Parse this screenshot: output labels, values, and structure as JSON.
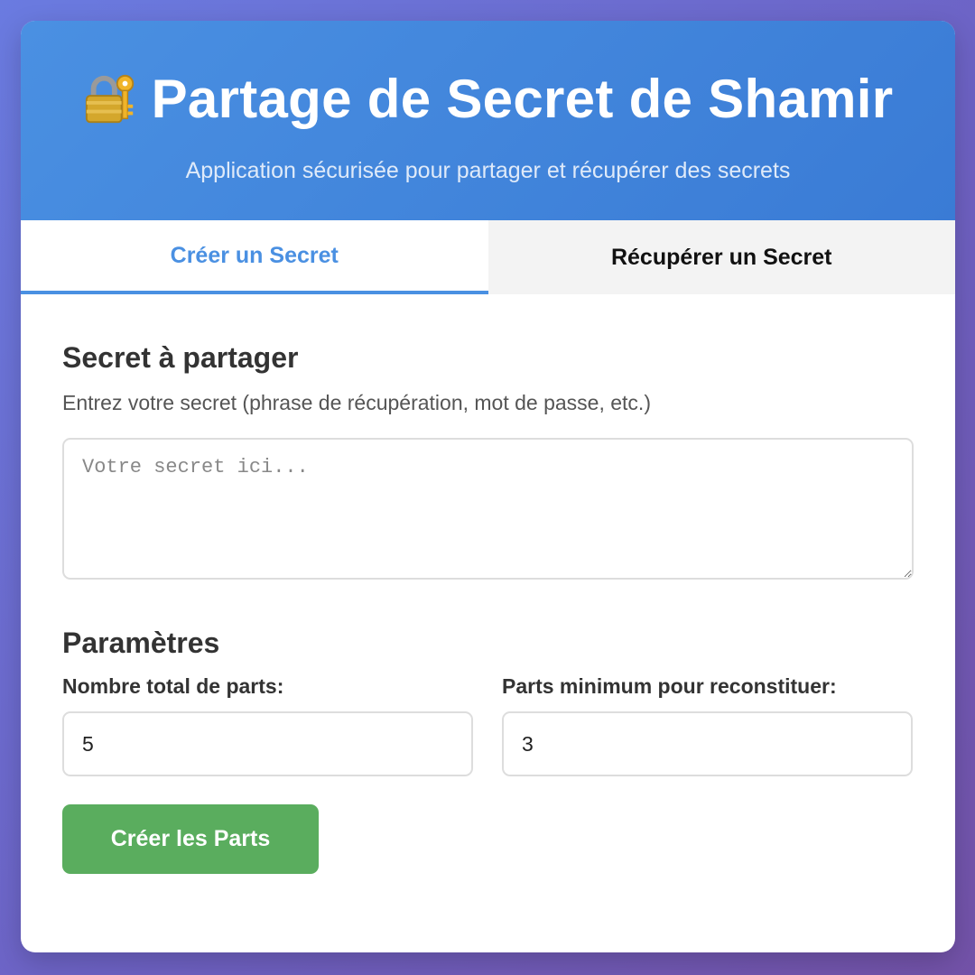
{
  "header": {
    "icon": "lock-with-key-icon",
    "title": "Partage de Secret de Shamir",
    "subtitle": "Application sécurisée pour partager et récupérer des secrets",
    "gradient": [
      "#4a90e2",
      "#3a7bd5"
    ]
  },
  "tabs": [
    {
      "label": "Créer un Secret",
      "active": true
    },
    {
      "label": "Récupérer un Secret",
      "active": false
    }
  ],
  "secret_section": {
    "title": "Secret à partager",
    "help": "Entrez votre secret (phrase de récupération, mot de passe, etc.)",
    "placeholder": "Votre secret ici...",
    "value": ""
  },
  "params": {
    "title": "Paramètres",
    "total_shares": {
      "label": "Nombre total de parts:",
      "value": "5"
    },
    "threshold": {
      "label": "Parts minimum pour reconstituer:",
      "value": "3"
    }
  },
  "actions": {
    "create_label": "Créer les Parts"
  },
  "colors": {
    "accent": "#4a90e2",
    "button": "#5aad5e",
    "tab_inactive_bg": "#f3f3f3"
  }
}
